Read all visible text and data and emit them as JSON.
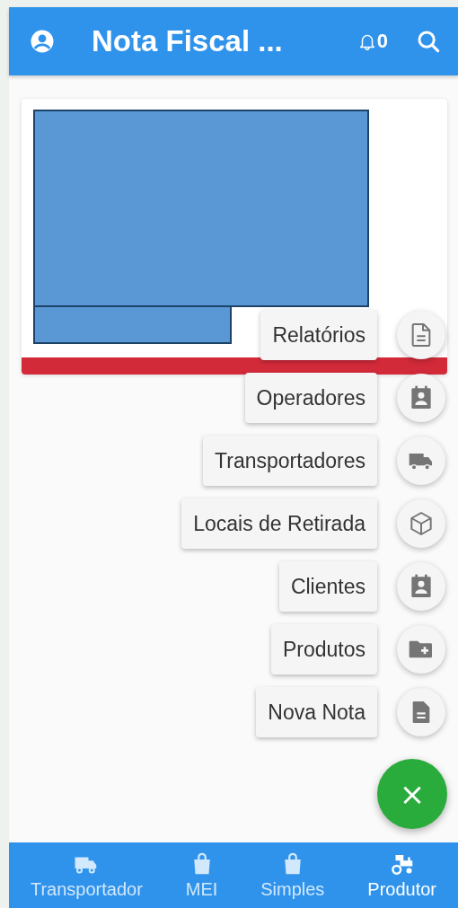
{
  "header": {
    "title": "Nota Fiscal ...",
    "notification_count": "0"
  },
  "card": {
    "kind": "redacted"
  },
  "speed_dial": [
    {
      "label": "Relatórios"
    },
    {
      "label": "Operadores"
    },
    {
      "label": "Transportadores"
    },
    {
      "label": "Locais de Retirada"
    },
    {
      "label": "Clientes"
    },
    {
      "label": "Produtos"
    },
    {
      "label": "Nova Nota"
    }
  ],
  "fab": {
    "label": "×"
  },
  "bottom_nav": [
    {
      "label": "Transportador",
      "selected": false
    },
    {
      "label": "MEI",
      "selected": false
    },
    {
      "label": "Simples",
      "selected": false
    },
    {
      "label": "Produtor",
      "selected": true
    }
  ]
}
